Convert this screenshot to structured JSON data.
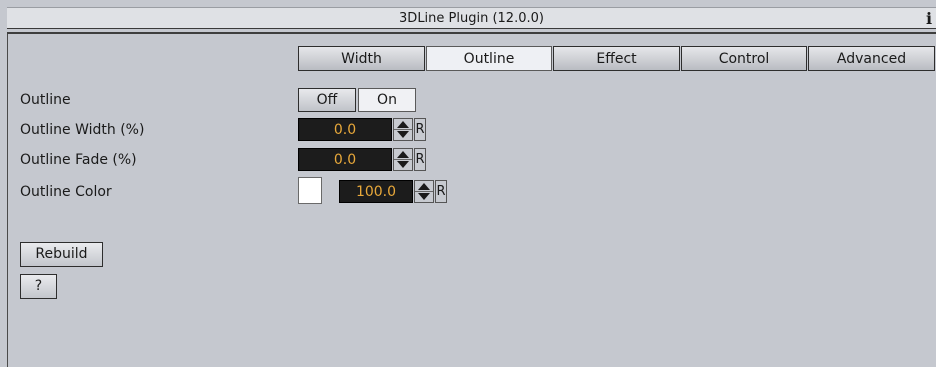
{
  "window": {
    "title": "3DLine Plugin (12.0.0)",
    "info_glyph": "i"
  },
  "tabs": [
    {
      "label": "Width",
      "active": false
    },
    {
      "label": "Outline",
      "active": true
    },
    {
      "label": "Effect",
      "active": false
    },
    {
      "label": "Control",
      "active": false
    },
    {
      "label": "Advanced",
      "active": false
    }
  ],
  "fields": {
    "outline": {
      "label": "Outline",
      "off_label": "Off",
      "on_label": "On",
      "selected": "On"
    },
    "outline_width": {
      "label": "Outline Width (%)",
      "value": "0.0",
      "reset_label": "R"
    },
    "outline_fade": {
      "label": "Outline Fade (%)",
      "value": "0.0",
      "reset_label": "R"
    },
    "outline_color": {
      "label": "Outline Color",
      "color": "#ffffff",
      "alpha_value": "100.0",
      "reset_label": "R"
    }
  },
  "buttons": {
    "rebuild_label": "Rebuild",
    "help_label": "?"
  },
  "colors": {
    "panel": "#c5c8cf",
    "numeric_text": "#e8a83a",
    "numeric_bg": "#1c1c1c"
  }
}
